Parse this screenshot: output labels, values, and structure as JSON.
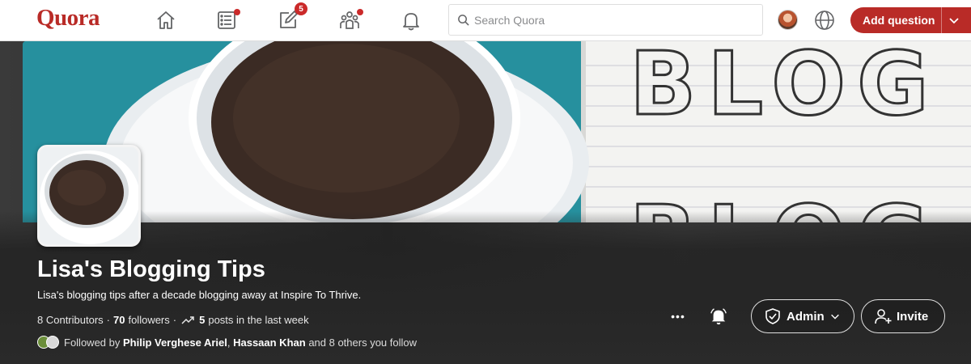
{
  "app": {
    "logo": "Quora"
  },
  "nav": {
    "icons": [
      {
        "name": "home-icon"
      },
      {
        "name": "following-icon",
        "dot": true
      },
      {
        "name": "answer-icon",
        "badge": "5"
      },
      {
        "name": "spaces-icon",
        "dot": true
      },
      {
        "name": "notifications-icon"
      }
    ],
    "search_placeholder": "Search Quora",
    "add_question_label": "Add question"
  },
  "space": {
    "title": "Lisa's Blogging Tips",
    "description": "Lisa's blogging tips after a decade blogging away at Inspire To Thrive.",
    "contributors": "8 Contributors",
    "followers_count": "70",
    "followers_label": "followers",
    "posts_count": "5",
    "posts_label": "posts in the last week",
    "followed_by_prefix": "Followed by",
    "followed_by_names": [
      "Philip Verghese Ariel",
      "Hassaan Khan"
    ],
    "followed_by_suffix": "and 8 others you follow",
    "cover_text": "BLOG"
  },
  "actions": {
    "more_label": "•••",
    "admin_label": "Admin",
    "invite_label": "Invite"
  },
  "colors": {
    "brand": "#b92b27",
    "badge": "#cb2a2a",
    "cover_teal": "#2a9aa8",
    "coffee": "#3b2b24"
  }
}
